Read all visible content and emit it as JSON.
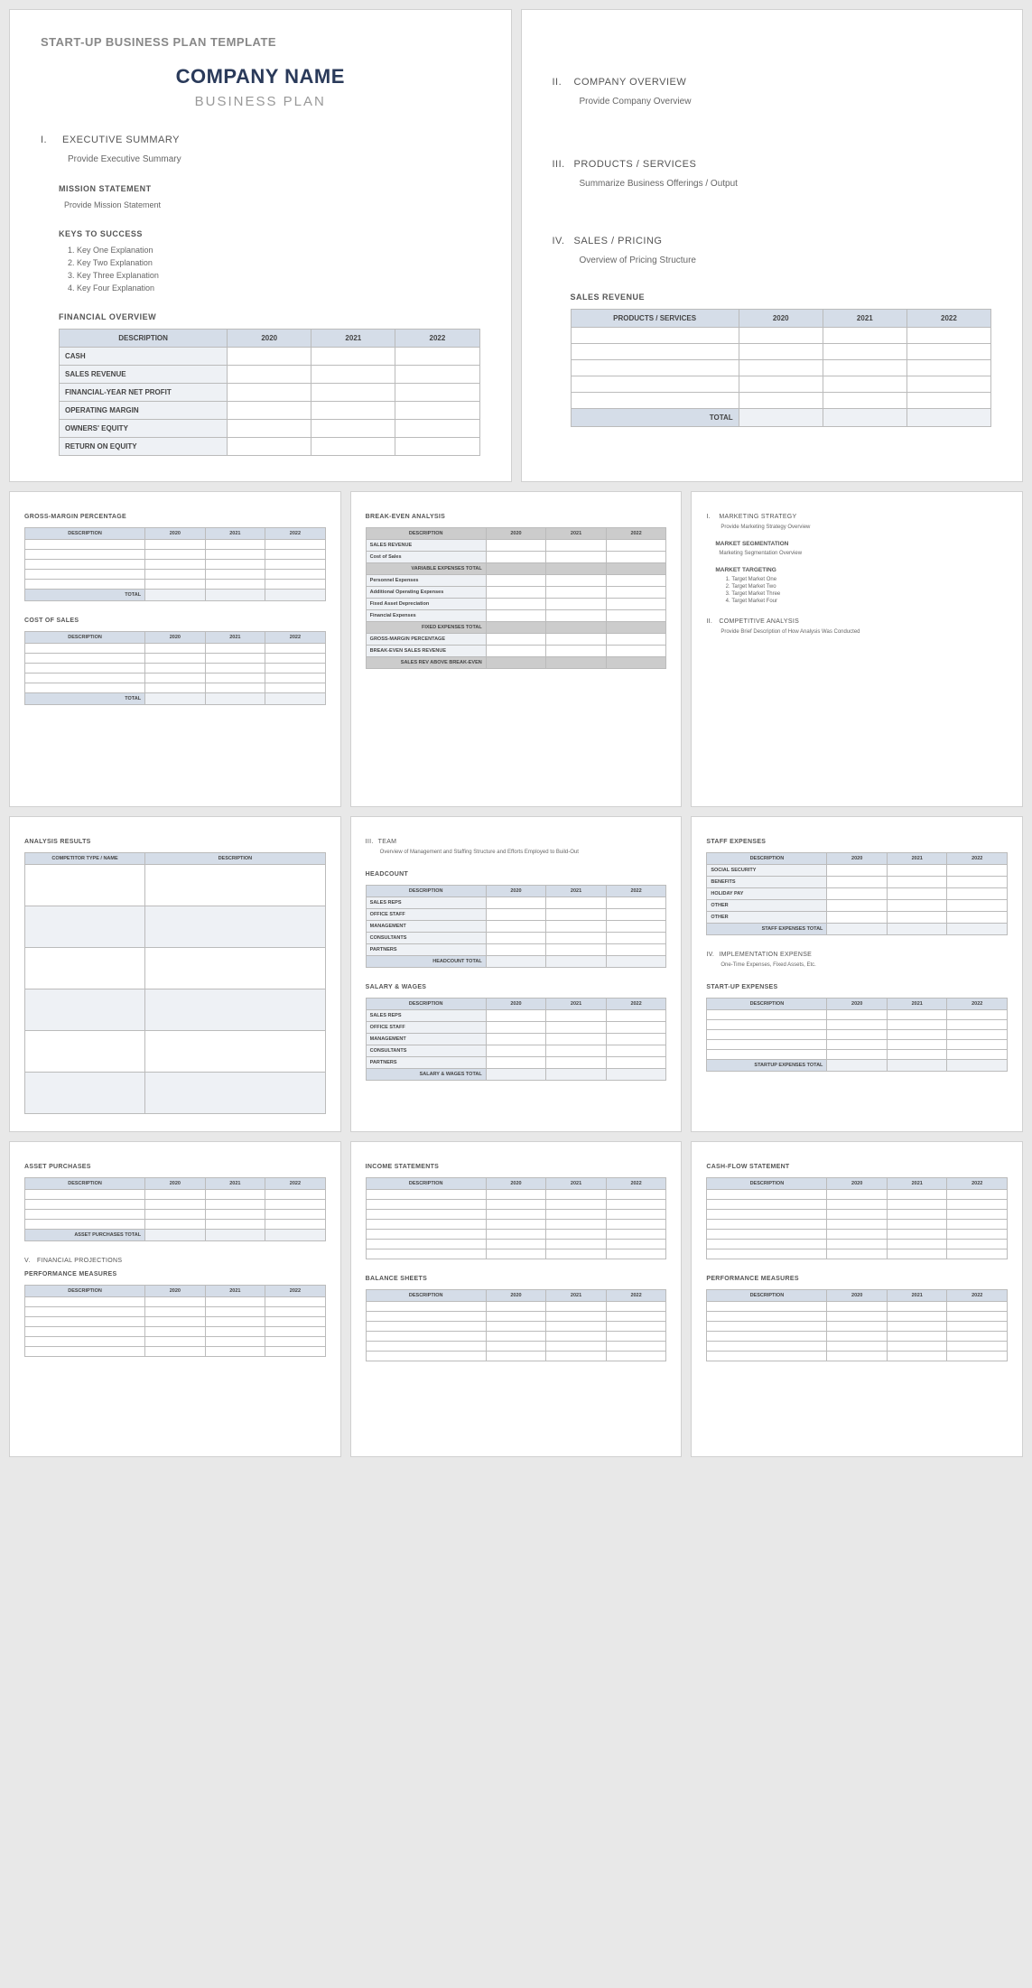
{
  "template_label": "START-UP BUSINESS PLAN TEMPLATE",
  "company_name": "COMPANY NAME",
  "subtitle": "BUSINESS PLAN",
  "years": [
    "2020",
    "2021",
    "2022"
  ],
  "p1": {
    "s1": {
      "num": "I.",
      "title": "EXECUTIVE SUMMARY",
      "body": "Provide Executive Summary"
    },
    "mission": {
      "title": "MISSION STATEMENT",
      "body": "Provide Mission Statement"
    },
    "keys": {
      "title": "KEYS TO SUCCESS",
      "items": [
        "Key One Explanation",
        "Key Two Explanation",
        "Key Three Explanation",
        "Key Four Explanation"
      ]
    },
    "fin": {
      "title": "FINANCIAL OVERVIEW",
      "desc": "DESCRIPTION",
      "rows": [
        "CASH",
        "SALES REVENUE",
        "FINANCIAL-YEAR NET PROFIT",
        "OPERATING MARGIN",
        "OWNERS' EQUITY",
        "RETURN ON EQUITY"
      ]
    }
  },
  "p2": {
    "s2": {
      "num": "II.",
      "title": "COMPANY OVERVIEW",
      "body": "Provide Company Overview"
    },
    "s3": {
      "num": "III.",
      "title": "PRODUCTS / SERVICES",
      "body": "Summarize Business Offerings / Output"
    },
    "s4": {
      "num": "IV.",
      "title": "SALES / PRICING",
      "body": "Overview of Pricing Structure"
    },
    "revenue": {
      "title": "SALES REVENUE",
      "header": "PRODUCTS / SERVICES",
      "total": "TOTAL"
    }
  },
  "p3": {
    "gm": {
      "title": "GROSS-MARGIN PERCENTAGE",
      "desc": "DESCRIPTION",
      "total": "TOTAL"
    },
    "cos": {
      "title": "COST OF SALES",
      "desc": "DESCRIPTION",
      "total": "TOTAL"
    }
  },
  "p4": {
    "be": {
      "title": "BREAK-EVEN ANALYSIS",
      "desc": "DESCRIPTION",
      "r1": "SALES REVENUE",
      "r2": "Cost of Sales",
      "sub1": "VARIABLE EXPENSES TOTAL",
      "r3": "Personnel Expenses",
      "r4": "Additional Operating Expenses",
      "r5": "Fixed Asset Depreciation",
      "r6": "Financial Expenses",
      "sub2": "FIXED EXPENSES TOTAL",
      "r7": "GROSS-MARGIN PERCENTAGE",
      "r8": "BREAK-EVEN SALES REVENUE",
      "sub3": "SALES REV ABOVE BREAK-EVEN"
    }
  },
  "p5": {
    "ms": {
      "num": "I.",
      "title": "MARKETING STRATEGY",
      "body": "Provide Marketing Strategy Overview"
    },
    "seg": {
      "title": "MARKET SEGMENTATION",
      "body": "Marketing Segmentation Overview"
    },
    "tgt": {
      "title": "MARKET TARGETING",
      "items": [
        "Target Market One",
        "Target Market Two",
        "Target Market Three",
        "Target Market Four"
      ]
    },
    "ca": {
      "num": "II.",
      "title": "COMPETITIVE ANALYSIS",
      "body": "Provide Brief Description of How Analysis Was Conducted"
    }
  },
  "p6": {
    "ar": {
      "title": "ANALYSIS RESULTS",
      "h1": "COMPETITOR TYPE / NAME",
      "h2": "DESCRIPTION"
    }
  },
  "p7": {
    "team": {
      "num": "III.",
      "title": "TEAM",
      "body": "Overview of Management and Staffing Structure and Efforts Employed to Build-Out"
    },
    "hc": {
      "title": "HEADCOUNT",
      "desc": "DESCRIPTION",
      "rows": [
        "SALES REPS",
        "OFFICE STAFF",
        "MANAGEMENT",
        "CONSULTANTS",
        "PARTNERS"
      ],
      "total": "HEADCOUNT TOTAL"
    },
    "sw": {
      "title": "SALARY & WAGES",
      "desc": "DESCRIPTION",
      "rows": [
        "SALES REPS",
        "OFFICE STAFF",
        "MANAGEMENT",
        "CONSULTANTS",
        "PARTNERS"
      ],
      "total": "SALARY & WAGES TOTAL"
    }
  },
  "p8": {
    "se": {
      "title": "STAFF EXPENSES",
      "desc": "DESCRIPTION",
      "rows": [
        "SOCIAL SECURITY",
        "BENEFITS",
        "HOLIDAY PAY",
        "OTHER",
        "OTHER"
      ],
      "total": "STAFF EXPENSES TOTAL"
    },
    "ie": {
      "num": "IV.",
      "title": "IMPLEMENTATION EXPENSE",
      "body": "One-Time Expenses, Fixed Assets, Etc."
    },
    "sue": {
      "title": "START-UP EXPENSES",
      "desc": "DESCRIPTION",
      "total": "STARTUP EXPENSES TOTAL"
    }
  },
  "p9": {
    "ap": {
      "title": "ASSET PURCHASES",
      "desc": "DESCRIPTION",
      "total": "ASSET PURCHASES TOTAL"
    },
    "fp": {
      "num": "V.",
      "title": "FINANCIAL PROJECTIONS"
    },
    "pm": {
      "title": "PERFORMANCE MEASURES",
      "desc": "DESCRIPTION"
    }
  },
  "p10": {
    "is": {
      "title": "INCOME STATEMENTS",
      "desc": "DESCRIPTION"
    },
    "bs": {
      "title": "BALANCE SHEETS",
      "desc": "DESCRIPTION"
    }
  },
  "p11": {
    "cf": {
      "title": "CASH-FLOW STATEMENT",
      "desc": "DESCRIPTION"
    },
    "pm": {
      "title": "PERFORMANCE MEASURES",
      "desc": "DESCRIPTION"
    }
  }
}
